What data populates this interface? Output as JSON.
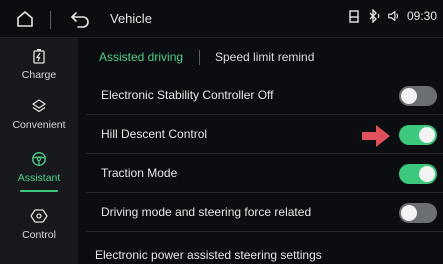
{
  "header": {
    "title": "Vehicle",
    "time": "09:30",
    "icons": [
      "home-icon",
      "back-icon",
      "device-icon",
      "bluetooth-icon",
      "volume-icon"
    ]
  },
  "sidebar": {
    "items": [
      {
        "label": "Charge",
        "icon": "battery-charge-icon",
        "active": false
      },
      {
        "label": "Convenient",
        "icon": "layers-icon",
        "active": false
      },
      {
        "label": "Assistant",
        "icon": "steering-wheel-icon",
        "active": true
      },
      {
        "label": "Control",
        "icon": "control-icon",
        "active": false
      }
    ]
  },
  "tabs": [
    {
      "label": "Assisted driving",
      "active": true
    },
    {
      "label": "Speed limit remind",
      "active": false
    }
  ],
  "settings": [
    {
      "label": "Electronic Stability Controller Off",
      "state": "off"
    },
    {
      "label": "Hill Descent Control",
      "state": "on"
    },
    {
      "label": "Traction Mode",
      "state": "on"
    },
    {
      "label": "Driving mode and steering force related",
      "state": "off"
    }
  ],
  "footer_item": "Electronic power assisted steering settings",
  "colors": {
    "accent": "#3cc97e",
    "toggle_off": "#6b6e73",
    "arrow": "#e0505d",
    "background": "#0b0d10",
    "sidebar": "#16181c"
  }
}
